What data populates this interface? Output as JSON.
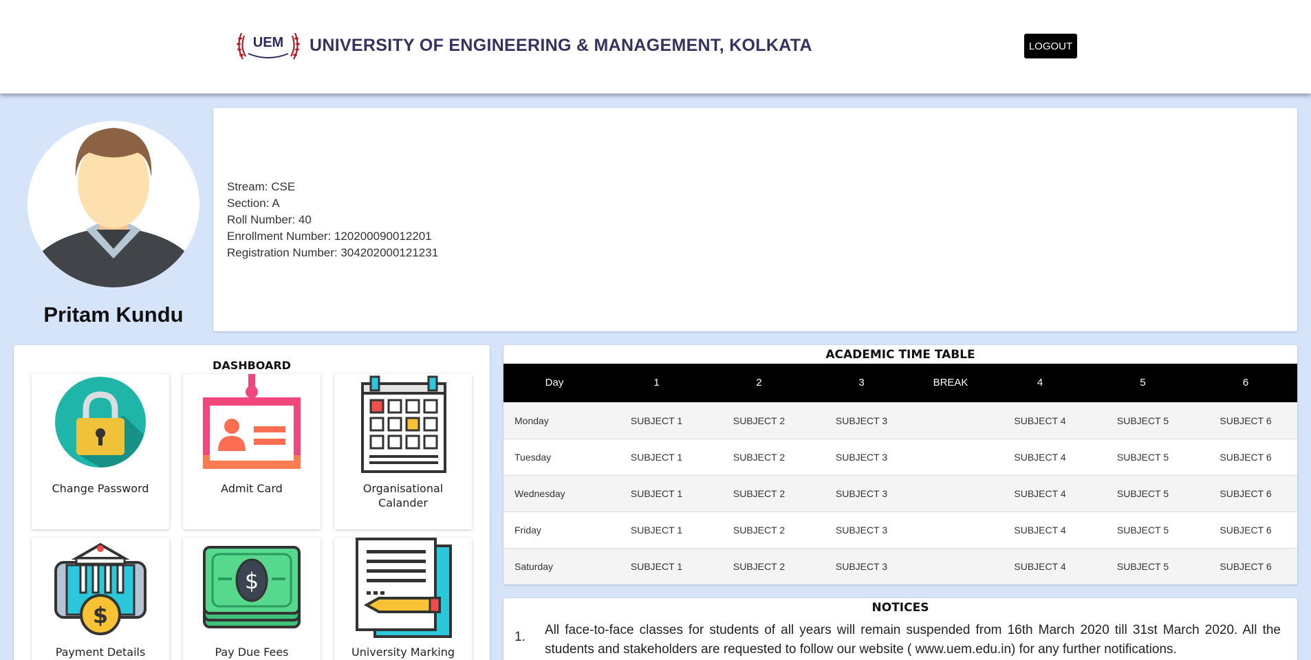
{
  "header": {
    "logo_text": "UEM",
    "title": "UNIVERSITY OF ENGINEERING & MANAGEMENT, KOLKATA",
    "logout_label": "LOGOUT"
  },
  "profile": {
    "name": "Pritam Kundu",
    "details": [
      "Stream: CSE",
      "Section: A",
      "Roll Number: 40",
      "Enrollment Number: 120200090012201",
      "Registration Number: 304202000121231"
    ]
  },
  "dashboard": {
    "title": "DASHBOARD",
    "tiles": [
      {
        "label": "Change Password",
        "icon": "lock-icon"
      },
      {
        "label": "Admit Card",
        "icon": "id-card-icon"
      },
      {
        "label": "Organisational Calander",
        "icon": "calendar-icon"
      },
      {
        "label": "Payment Details",
        "icon": "payment-icon"
      },
      {
        "label": "Pay Due Fees",
        "icon": "money-icon"
      },
      {
        "label": "University Marking",
        "icon": "document-icon"
      }
    ]
  },
  "timetable": {
    "title": "ACADEMIC TIME TABLE",
    "headers": [
      "Day",
      "1",
      "2",
      "3",
      "BREAK",
      "4",
      "5",
      "6"
    ],
    "rows": [
      [
        "Monday",
        "SUBJECT 1",
        "SUBJECT 2",
        "SUBJECT 3",
        "",
        "SUBJECT 4",
        "SUBJECT 5",
        "SUBJECT 6"
      ],
      [
        "Tuesday",
        "SUBJECT 1",
        "SUBJECT 2",
        "SUBJECT 3",
        "",
        "SUBJECT 4",
        "SUBJECT 5",
        "SUBJECT 6"
      ],
      [
        "Wednesday",
        "SUBJECT 1",
        "SUBJECT 2",
        "SUBJECT 3",
        "",
        "SUBJECT 4",
        "SUBJECT 5",
        "SUBJECT 6"
      ],
      [
        "Friday",
        "SUBJECT 1",
        "SUBJECT 2",
        "SUBJECT 3",
        "",
        "SUBJECT 4",
        "SUBJECT 5",
        "SUBJECT 6"
      ],
      [
        "Saturday",
        "SUBJECT 1",
        "SUBJECT 2",
        "SUBJECT 3",
        "",
        "SUBJECT 4",
        "SUBJECT 5",
        "SUBJECT 6"
      ]
    ]
  },
  "notices": {
    "title": "NOTICES",
    "items": [
      {
        "number": "1.",
        "text": "All face-to-face classes for students of all years will remain suspended from 16th March 2020 till 31st March 2020. All the students and stakeholders are requested to follow our website ( www.uem.edu.in) for any further notifications."
      }
    ]
  },
  "colors": {
    "background": "#d6e4fa",
    "title": "#33335e",
    "header_black": "#000000"
  }
}
